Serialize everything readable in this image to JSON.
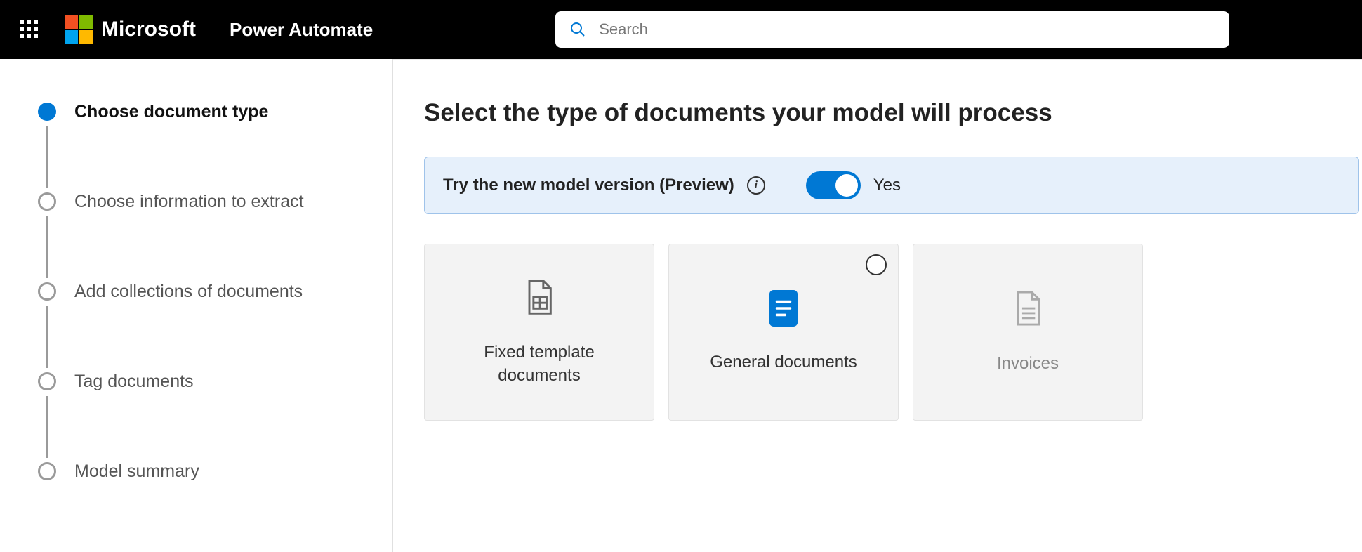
{
  "header": {
    "brand": "Microsoft",
    "app": "Power Automate",
    "search_placeholder": "Search"
  },
  "sidebar": {
    "steps": [
      {
        "label": "Choose document type",
        "active": true
      },
      {
        "label": "Choose information to extract",
        "active": false
      },
      {
        "label": "Add collections of documents",
        "active": false
      },
      {
        "label": "Tag documents",
        "active": false
      },
      {
        "label": "Model summary",
        "active": false
      }
    ]
  },
  "main": {
    "title": "Select the type of documents your model will process",
    "preview": {
      "text": "Try the new model version (Preview)",
      "toggle_on": true,
      "toggle_label": "Yes"
    },
    "cards": [
      {
        "label": "Fixed template documents",
        "kind": "template",
        "selected": false,
        "show_radio": false,
        "disabled": false
      },
      {
        "label": "General documents",
        "kind": "general",
        "selected": false,
        "show_radio": true,
        "disabled": false
      },
      {
        "label": "Invoices",
        "kind": "invoice",
        "selected": false,
        "show_radio": false,
        "disabled": true
      }
    ]
  }
}
